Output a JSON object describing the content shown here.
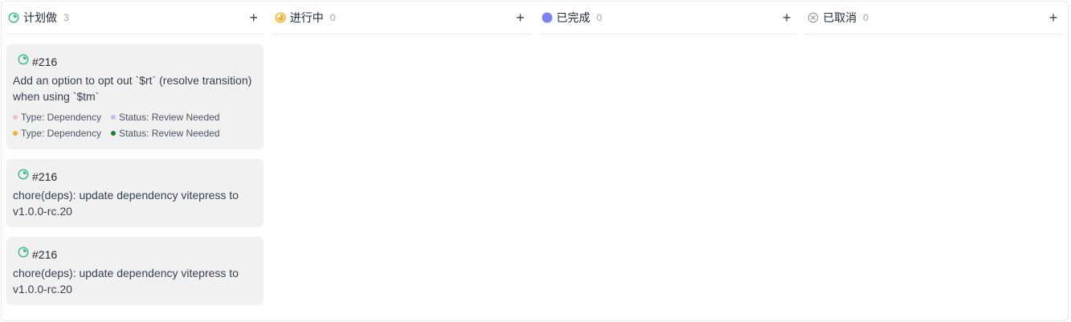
{
  "columns": [
    {
      "title": "计划做",
      "count": "3",
      "add_label": "+",
      "icon": "circle-quarter-icon",
      "cards": [
        {
          "id": "#216",
          "title": "Add an option to opt out `$rt` (resolve transition) when using `$tm`",
          "labels": [
            [
              {
                "text": "Type: Dependency",
                "color": "#f5b8d6"
              },
              {
                "text": "Status: Review Needed",
                "color": "#c9b8f5"
              }
            ],
            [
              {
                "text": "Type: Dependency",
                "color": "#f0b429"
              },
              {
                "text": "Status: Review Needed",
                "color": "#1a7f37"
              }
            ]
          ]
        },
        {
          "id": "#216",
          "title": "chore(deps): update dependency vitepress to v1.0.0-rc.20",
          "labels": []
        },
        {
          "id": "#216",
          "title": "chore(deps): update dependency vitepress to v1.0.0-rc.20",
          "labels": []
        }
      ]
    },
    {
      "title": "进行中",
      "count": "0",
      "add_label": "+",
      "icon": "circle-half-icon",
      "cards": []
    },
    {
      "title": "已完成",
      "count": "0",
      "add_label": "+",
      "icon": "circle-filled-icon",
      "cards": []
    },
    {
      "title": "已取消",
      "count": "0",
      "add_label": "+",
      "icon": "circle-x-icon",
      "cards": []
    }
  ],
  "colors": {
    "planned": "#3fbf8f",
    "in_progress": "#f0b429",
    "done": "#7b83f2",
    "cancelled": "#9ca3af"
  }
}
